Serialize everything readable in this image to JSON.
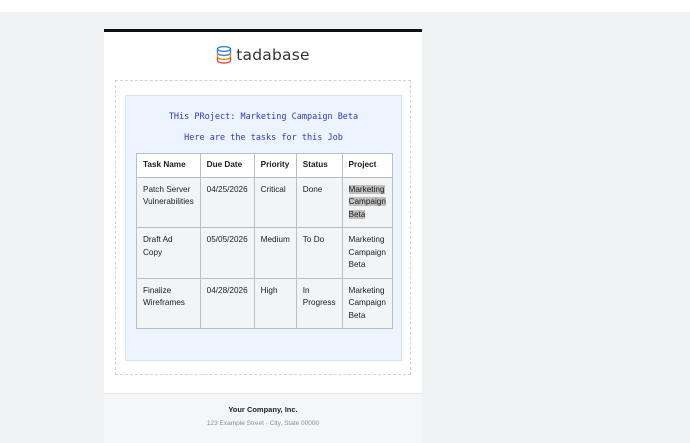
{
  "brand": {
    "name": "tadabase",
    "logo_icon": "database-stack-icon"
  },
  "intro": {
    "project_line": "THis PRoject: Marketing Campaign Beta",
    "tasks_line": "Here are the tasks for this Job"
  },
  "table": {
    "headers": [
      "Task Name",
      "Due Date",
      "Priority",
      "Status",
      "Project"
    ],
    "rows": [
      [
        "Patch Server Vulnerabilities",
        "04/25/2026",
        "Critical",
        "Done",
        "Marketing Campaign Beta"
      ],
      [
        "Draft Ad Copy",
        "05/05/2026",
        "Medium",
        "To Do",
        "Marketing Campaign Beta"
      ],
      [
        "Finalize Wireframes",
        "04/28/2026",
        "High",
        "In Progress",
        "Marketing Campaign Beta"
      ]
    ]
  },
  "footer": {
    "company": "Your Company, Inc.",
    "address": "123 Example Street · City, State 00000"
  },
  "colors": {
    "accent_text": "#2b3db8",
    "panel_bg": "#edf3ff",
    "header_bar": "#111111"
  }
}
